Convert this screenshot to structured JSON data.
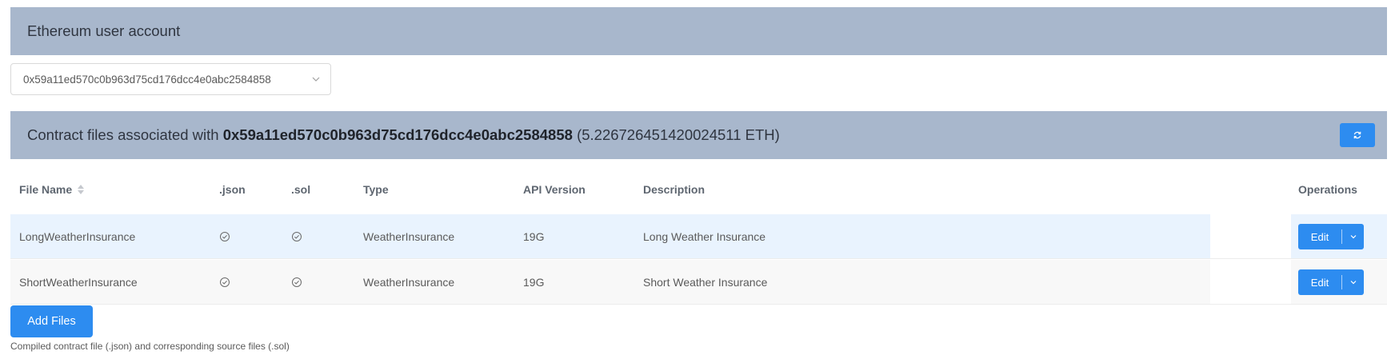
{
  "account_section": {
    "title": "Ethereum user account",
    "selected_account": "0x59a11ed570c0b963d75cd176dcc4e0abc2584858"
  },
  "contracts_section": {
    "title_prefix": "Contract files associated with",
    "address": "0x59a11ed570c0b963d75cd176dcc4e0abc2584858",
    "balance": "(5.226726451420024511 ETH)",
    "refresh_icon": "refresh-icon"
  },
  "table": {
    "headers": {
      "file_name": "File Name",
      "json": ".json",
      "sol": ".sol",
      "type": "Type",
      "api_version": "API Version",
      "description": "Description",
      "operations": "Operations"
    },
    "rows": [
      {
        "file_name": "LongWeatherInsurance",
        "json_icon": "check-circle-icon",
        "sol_icon": "check-circle-icon",
        "type": "WeatherInsurance",
        "api_version": "19G",
        "description": "Long Weather Insurance",
        "edit_label": "Edit"
      },
      {
        "file_name": "ShortWeatherInsurance",
        "json_icon": "check-circle-icon",
        "sol_icon": "check-circle-icon",
        "type": "WeatherInsurance",
        "api_version": "19G",
        "description": "Short Weather Insurance",
        "edit_label": "Edit"
      }
    ]
  },
  "footer": {
    "add_files_label": "Add Files",
    "hint": "Compiled contract file (.json) and corresponding source files (.sol)"
  },
  "colors": {
    "header_bg": "#a8b7cc",
    "primary": "#2d8cf0",
    "row_highlight": "#e9f3fe",
    "row_alt": "#f8f8f8"
  }
}
